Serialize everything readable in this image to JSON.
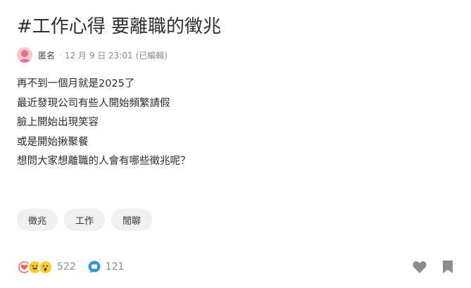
{
  "post": {
    "title": "#工作心得 要離職的徵兆",
    "author": "匿名",
    "separator": "·",
    "time": "12 月 9 日 23:01",
    "edited": "(已編輯)",
    "body_lines": [
      "再不到一個月就是2025了",
      "最近發現公司有些人開始頻繁請假",
      "臉上開始出現笑容",
      "或是開始揪聚餐",
      "想問大家想離職的人會有哪些徵兆呢？"
    ]
  },
  "tags": [
    "徵兆",
    "工作",
    "閒聊"
  ],
  "footer": {
    "reaction_icons": [
      "heart-emoji-icon",
      "laughing-emoji-icon",
      "surprised-emoji-icon"
    ],
    "reaction_count": "522",
    "comment_count": "121",
    "like_icon": "heart-icon",
    "bookmark_icon": "bookmark-icon"
  },
  "colors": {
    "heart": "#ff5c5c",
    "laugh": "#ffcc33",
    "comment": "#3397cf",
    "muted_icon": "#8c8c8c",
    "avatar": "#f6c6cf"
  }
}
